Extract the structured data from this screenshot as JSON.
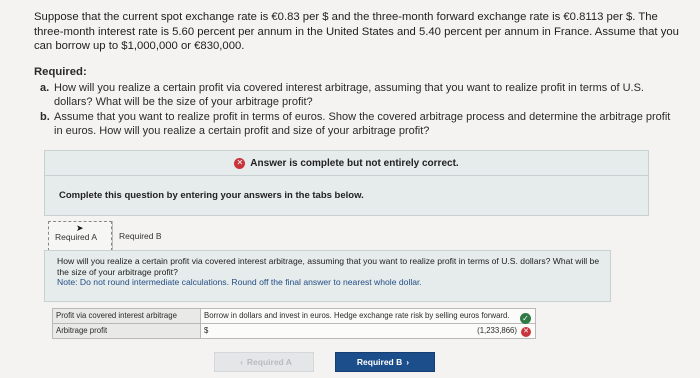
{
  "problem": {
    "intro": "Suppose that the current spot exchange rate is €0.83 per $ and the three-month forward exchange rate is €0.8113 per $. The three-month interest rate is 5.60 percent per annum in the United States and 5.40 percent per annum in France. Assume that you can borrow up to $1,000,000 or €830,000.",
    "required_heading": "Required:",
    "requirements": [
      {
        "letter": "a.",
        "text": "How will you realize a certain profit via covered interest arbitrage, assuming that you want to realize profit in terms of U.S. dollars? What will be the size of your arbitrage profit?"
      },
      {
        "letter": "b.",
        "text": "Assume that you want to realize profit in terms of euros. Show the covered arbitrage process and determine the arbitrage profit in euros. How will you realize a certain profit and size of your arbitrage profit?"
      }
    ]
  },
  "status": {
    "banner": "Answer is complete but not entirely correct.",
    "instruction": "Complete this question by entering your answers in the tabs below."
  },
  "tabs": [
    {
      "label": "Required A"
    },
    {
      "label": "Required B"
    }
  ],
  "question_a": {
    "text": "How will you realize a certain profit via covered interest arbitrage, assuming that you want to realize profit in terms of U.S. dollars? What will be the size of your arbitrage profit?",
    "note": "Note: Do not round intermediate calculations. Round off the final answer to nearest whole dollar."
  },
  "answers": {
    "row1_label": "Profit via covered interest arbitrage",
    "row1_value": "Borrow in dollars and invest in euros. Hedge exchange rate risk by selling euros forward.",
    "row2_label": "Arbitrage profit",
    "row2_currency": "$",
    "row2_value": "(1,233,866)"
  },
  "nav": {
    "prev_label": "Required A",
    "next_label": "Required B"
  }
}
